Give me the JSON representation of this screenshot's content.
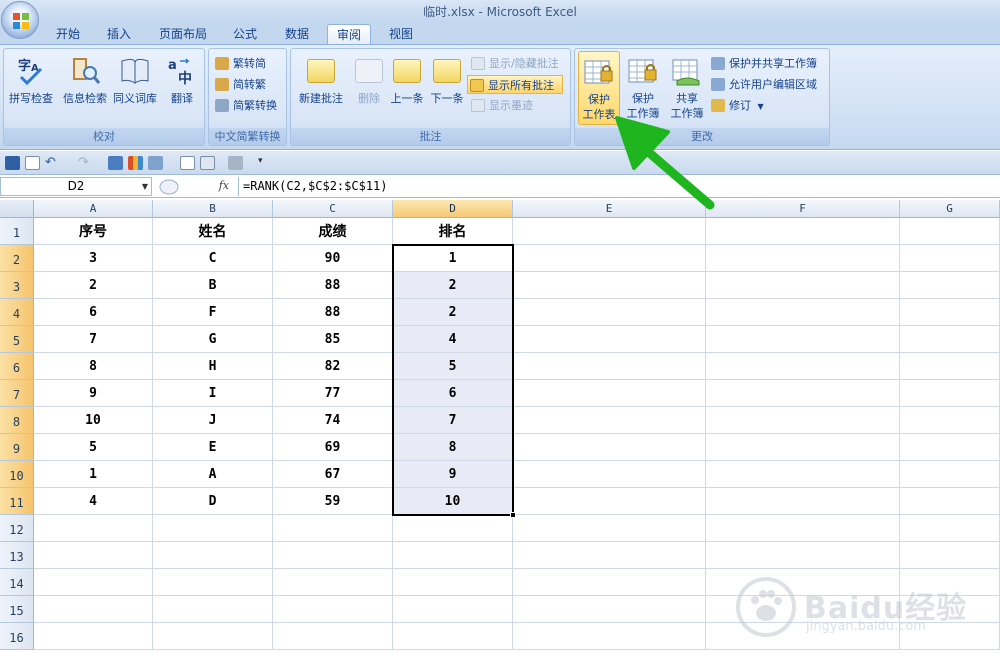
{
  "window": {
    "title": "临时.xlsx - Microsoft Excel"
  },
  "tabs": [
    "开始",
    "插入",
    "页面布局",
    "公式",
    "数据",
    "审阅",
    "视图"
  ],
  "active_tab": "审阅",
  "ribbon": {
    "proofing": {
      "label": "校对",
      "spell": "拼写检查",
      "research": "信息检索",
      "thesaurus": "同义词库",
      "translate": "翻译"
    },
    "chinese": {
      "label": "中文简繁转换",
      "to_simplified": "繁转简",
      "to_traditional": "简转繁",
      "convert": "简繁转换"
    },
    "comments": {
      "label": "批注",
      "new": "新建批注",
      "delete": "删除",
      "prev": "上一条",
      "next": "下一条",
      "show_hide": "显示/隐藏批注",
      "show_all": "显示所有批注",
      "show_ink": "显示墨迹"
    },
    "changes": {
      "label": "更改",
      "protect_sheet_1": "保护",
      "protect_sheet_2": "工作表",
      "protect_book_1": "保护",
      "protect_book_2": "工作簿",
      "share_book_1": "共享",
      "share_book_2": "工作簿",
      "protect_share": "保护并共享工作簿",
      "allow_edit": "允许用户编辑区域",
      "track": "修订"
    }
  },
  "formula_bar": {
    "name_box": "D2",
    "fx": "fx",
    "formula": "=RANK(C2,$C$2:$C$11)"
  },
  "columns": [
    "A",
    "B",
    "C",
    "D",
    "E",
    "F",
    "G"
  ],
  "rows": [
    "1",
    "2",
    "3",
    "4",
    "5",
    "6",
    "7",
    "8",
    "9",
    "10",
    "11",
    "12",
    "13",
    "14",
    "15",
    "16"
  ],
  "table": {
    "headers": [
      "序号",
      "姓名",
      "成绩",
      "排名"
    ],
    "data": [
      [
        "3",
        "C",
        "90",
        "1"
      ],
      [
        "2",
        "B",
        "88",
        "2"
      ],
      [
        "6",
        "F",
        "88",
        "2"
      ],
      [
        "7",
        "G",
        "85",
        "4"
      ],
      [
        "8",
        "H",
        "82",
        "5"
      ],
      [
        "9",
        "I",
        "77",
        "6"
      ],
      [
        "10",
        "J",
        "74",
        "7"
      ],
      [
        "5",
        "E",
        "69",
        "8"
      ],
      [
        "1",
        "A",
        "67",
        "9"
      ],
      [
        "4",
        "D",
        "59",
        "10"
      ]
    ]
  },
  "watermark": {
    "brand": "Baidu经验",
    "url": "jingyan.baidu.com"
  },
  "colors": {
    "ribbon": "#d3e2f5",
    "selection_header": "#f7c974",
    "arrow": "#1fb51f"
  }
}
